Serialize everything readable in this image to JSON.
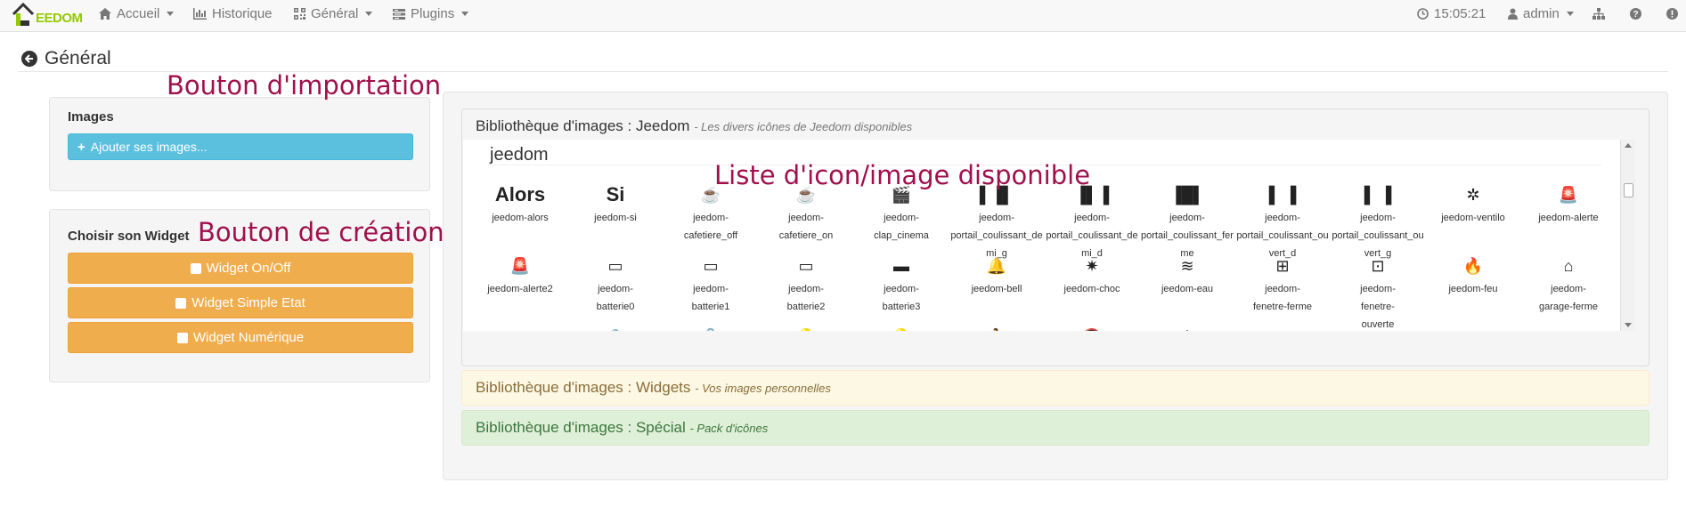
{
  "navbar": {
    "logo_text": "EEDOM",
    "items": [
      {
        "label": "Accueil"
      },
      {
        "label": "Historique"
      },
      {
        "label": "Général"
      },
      {
        "label": "Plugins"
      }
    ],
    "clock": "15:05:21",
    "user": "admin"
  },
  "page": {
    "title": "Général"
  },
  "annotations": {
    "import": "Bouton d'importation",
    "creation": "Bouton de création",
    "list": "Liste d'icon/image disponible"
  },
  "images_panel": {
    "title": "Images",
    "add_button": "Ajouter ses images..."
  },
  "widget_panel": {
    "title": "Choisir son Widget",
    "buttons": [
      "Widget On/Off",
      "Widget Simple Etat",
      "Widget Numérique"
    ]
  },
  "libraries": {
    "jeedom": {
      "title": "Bibliothèque d'images : Jeedom",
      "subtitle": "- Les divers icônes de Jeedom disponibles"
    },
    "widgets": {
      "title": "Bibliothèque d'images : Widgets",
      "subtitle": "- Vos images personnelles"
    },
    "special": {
      "title": "Bibliothèque d'images : Spécial",
      "subtitle": "- Pack d'icônes"
    }
  },
  "icon_group": {
    "title": "jeedom",
    "rows": [
      [
        {
          "glyph": "Alors",
          "label": "jeedom-alors"
        },
        {
          "glyph": "Si",
          "label": "jeedom-si"
        },
        {
          "glyph": "☕",
          "label": "jeedom-\ncafetiere_off"
        },
        {
          "glyph": "☕",
          "label": "jeedom-\ncafetiere_on"
        },
        {
          "glyph": "🎬",
          "label": "jeedom-\nclap_cinema"
        },
        {
          "glyph": "▌▐▌",
          "label": "jeedom-\nportail_coulissant_demi_g"
        },
        {
          "glyph": "▐▌▐",
          "label": "jeedom-\nportail_coulissant_demi_d"
        },
        {
          "glyph": "▐█▌",
          "label": "jeedom-\nportail_coulissant_ferme"
        },
        {
          "glyph": "▌ ▐",
          "label": "jeedom-\nportail_coulissant_ouvert_d"
        },
        {
          "glyph": "▌ ▐",
          "label": "jeedom-\nportail_coulissant_ouvert_g"
        },
        {
          "glyph": "✲",
          "label": "jeedom-ventilo"
        },
        {
          "glyph": "🚨",
          "label": "jeedom-alerte"
        }
      ],
      [
        {
          "glyph": "🚨",
          "label": "jeedom-alerte2"
        },
        {
          "glyph": "▭",
          "label": "jeedom-\nbatterie0"
        },
        {
          "glyph": "▭",
          "label": "jeedom-\nbatterie1"
        },
        {
          "glyph": "▭",
          "label": "jeedom-\nbatterie2"
        },
        {
          "glyph": "▬",
          "label": "jeedom-\nbatterie3"
        },
        {
          "glyph": "🔔",
          "label": "jeedom-bell"
        },
        {
          "glyph": "✷",
          "label": "jeedom-choc"
        },
        {
          "glyph": "≋",
          "label": "jeedom-eau"
        },
        {
          "glyph": "⊞",
          "label": "jeedom-\nfenetre-ferme"
        },
        {
          "glyph": "⊡",
          "label": "jeedom-\nfenetre-\nouverte"
        },
        {
          "glyph": "🔥",
          "label": "jeedom-feu"
        },
        {
          "glyph": "⌂",
          "label": "jeedom-\ngarage-ferme"
        }
      ],
      [
        {
          "glyph": "⌂",
          "label": ""
        },
        {
          "glyph": "🔒",
          "label": ""
        },
        {
          "glyph": "🔓",
          "label": ""
        },
        {
          "glyph": "💡",
          "label": ""
        },
        {
          "glyph": "💡",
          "label": ""
        },
        {
          "glyph": "🏃",
          "label": ""
        },
        {
          "glyph": "🔕",
          "label": ""
        },
        {
          "glyph": "⏻",
          "label": ""
        },
        {
          "glyph": "◡",
          "label": ""
        },
        {
          "glyph": "▥",
          "label": ""
        },
        {
          "glyph": "▥",
          "label": ""
        },
        {
          "glyph": "▥",
          "label": ""
        }
      ]
    ]
  },
  "colors": {
    "accent_info": "#5bc0de",
    "accent_warning": "#f0ad4e",
    "annotation": "#a0104d",
    "logo_green": "#94ca02"
  }
}
